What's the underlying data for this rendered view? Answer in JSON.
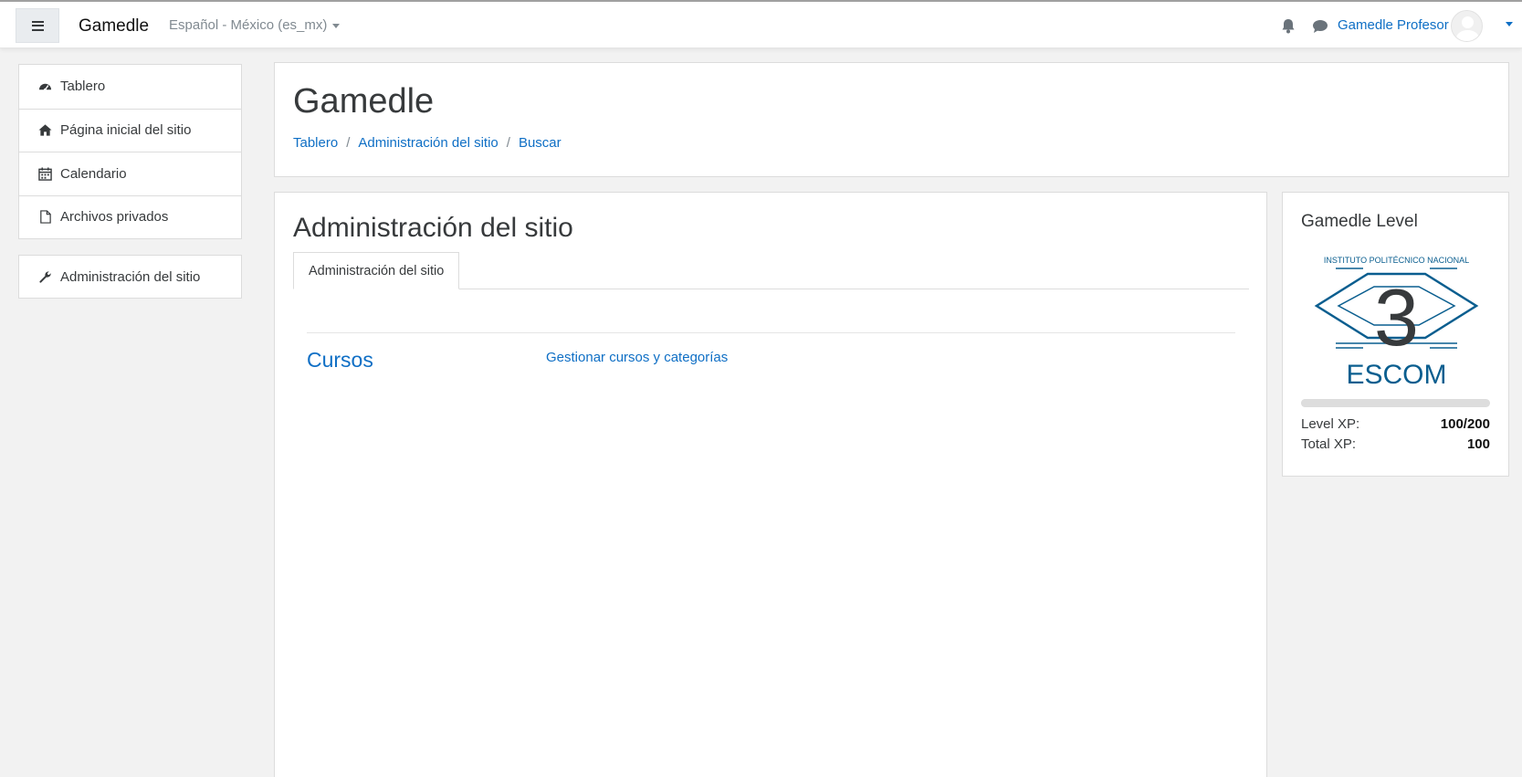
{
  "navbar": {
    "brand": "Gamedle",
    "language": "Español - México (es_mx)",
    "user_name": "Gamedle Profesor"
  },
  "drawer": {
    "items": [
      {
        "label": "Tablero",
        "icon": "dashboard-icon"
      },
      {
        "label": "Página inicial del sitio",
        "icon": "home-icon"
      },
      {
        "label": "Calendario",
        "icon": "calendar-icon"
      },
      {
        "label": "Archivos privados",
        "icon": "file-icon"
      }
    ],
    "admin_item": {
      "label": "Administración del sitio",
      "icon": "wrench-icon"
    }
  },
  "page_header": {
    "title": "Gamedle",
    "breadcrumb": [
      "Tablero",
      "Administración del sitio",
      "Buscar"
    ]
  },
  "main": {
    "heading": "Administración del sitio",
    "tab_label": "Administración del sitio",
    "category_title": "Cursos",
    "category_link": "Gestionar cursos y categorías"
  },
  "level_block": {
    "title": "Gamedle Level",
    "logo_text_top": "INSTITUTO POLITÉCNICO NACIONAL",
    "logo_number": "3",
    "logo_text_bottom": "ESCOM",
    "progress_fraction": 0.5,
    "level_xp_label": "Level XP:",
    "level_xp_value": "100/200",
    "total_xp_label": "Total XP:",
    "total_xp_value": "100"
  },
  "colors": {
    "link": "#0f6fc5",
    "text": "#373a3c",
    "muted": "#818a91",
    "logo_blue": "#0a5e8f"
  }
}
